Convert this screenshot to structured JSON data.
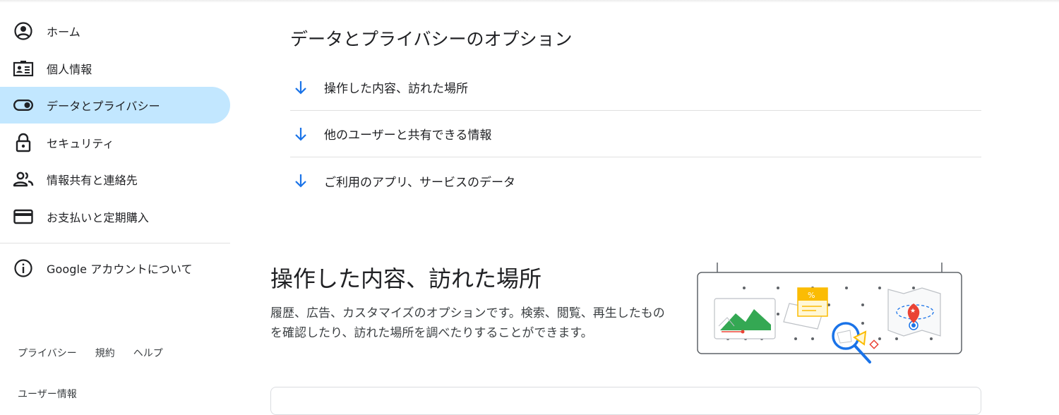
{
  "sidebar": {
    "items": [
      {
        "label": "ホーム",
        "icon": "account-circle-icon"
      },
      {
        "label": "個人情報",
        "icon": "id-card-icon"
      },
      {
        "label": "データとプライバシー",
        "icon": "toggle-icon",
        "active": true
      },
      {
        "label": "セキュリティ",
        "icon": "lock-icon"
      },
      {
        "label": "情報共有と連絡先",
        "icon": "people-icon"
      },
      {
        "label": "お支払いと定期購入",
        "icon": "credit-card-icon"
      }
    ],
    "about": {
      "label": "Google アカウントについて",
      "icon": "info-icon"
    }
  },
  "footer": {
    "privacy": "プライバシー",
    "terms": "規約",
    "help": "ヘルプ",
    "user_info": "ユーザー情報"
  },
  "main": {
    "section_title": "データとプライバシーのオプション",
    "options": [
      {
        "label": "操作した内容、訪れた場所",
        "icon": "arrow-down-icon"
      },
      {
        "label": "他のユーザーと共有できる情報",
        "icon": "arrow-down-icon"
      },
      {
        "label": "ご利用のアプリ、サービスのデータ",
        "icon": "arrow-down-icon"
      }
    ],
    "activity": {
      "title": "操作した内容、訪れた場所",
      "description": "履歴、広告、カスタマイズのオプションです。検索、閲覧、再生したものを確認したり、訪れた場所を調べたりすることができます。"
    }
  },
  "colors": {
    "accent_blue": "#1a73e8",
    "active_bg": "#c2e7ff",
    "map_green": "#34a853",
    "pin_red": "#ea4335",
    "card_yellow": "#fbbc04"
  }
}
